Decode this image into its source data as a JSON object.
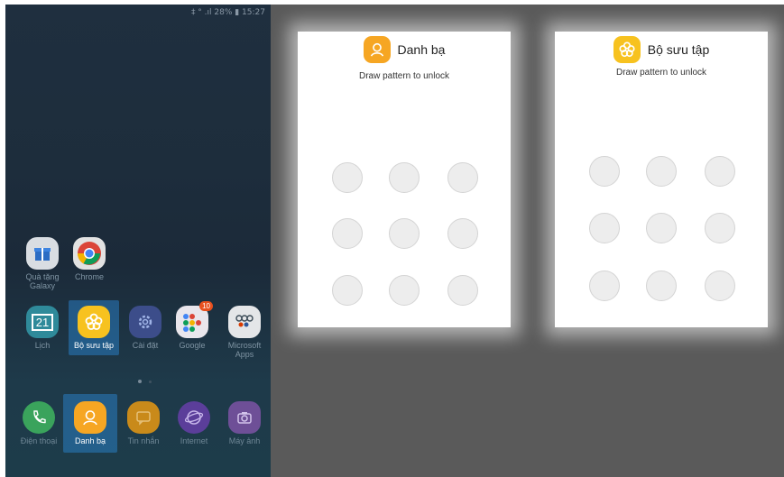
{
  "status_bar": "‡ ° .ıl 28% ▮ 15:27",
  "home": {
    "row1": [
      {
        "label": "Quà tặng Galaxy",
        "icon": "gift-icon"
      },
      {
        "label": "Chrome",
        "icon": "chrome-icon"
      }
    ],
    "row2": [
      {
        "label": "Lịch",
        "icon": "calendar-icon",
        "badge": "21"
      },
      {
        "label": "Bộ sưu tập",
        "icon": "gallery-flower-icon"
      },
      {
        "label": "Cài đặt",
        "icon": "settings-gear-icon"
      },
      {
        "label": "Google",
        "icon": "google-folder-icon",
        "badge": "10"
      },
      {
        "label": "Microsoft Apps",
        "icon": "microsoft-folder-icon"
      }
    ],
    "dock": [
      {
        "label": "Điện thoại",
        "icon": "phone-icon"
      },
      {
        "label": "Danh bạ",
        "icon": "contacts-icon"
      },
      {
        "label": "Tin nhắn",
        "icon": "messages-icon"
      },
      {
        "label": "Internet",
        "icon": "internet-icon"
      },
      {
        "label": "Máy ảnh",
        "icon": "camera-icon"
      }
    ]
  },
  "lock_screens": [
    {
      "app": "Danh bạ",
      "prompt": "Draw pattern to unlock",
      "icon": "contacts-icon"
    },
    {
      "app": "Bộ sưu tập",
      "prompt": "Draw pattern to unlock",
      "icon": "gallery-flower-icon"
    }
  ],
  "colors": {
    "accent_orange": "#f6a623",
    "accent_yellow": "#f7c21f",
    "highlight": "#2d8cdc"
  }
}
